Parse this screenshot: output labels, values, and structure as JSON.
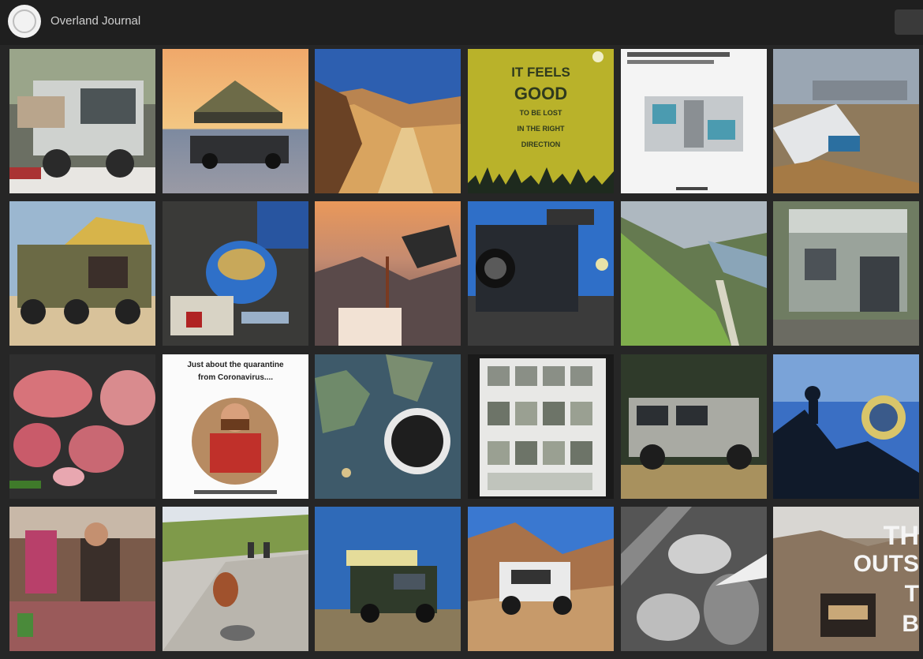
{
  "header": {
    "account_name": "Overland Journal",
    "avatar_icon": "profile-avatar-icon"
  },
  "posts": {
    "quote_card": {
      "line1": "IT FEELS",
      "line2": "GOOD",
      "line3": "TO BE LOST",
      "line4": "IN THE RIGHT",
      "line5": "DIRECTION"
    },
    "quarantine_card": {
      "line1": "Just about the quarantine",
      "line2": "from Coronavirus...."
    },
    "outside_card": {
      "line1": "TH",
      "line2": "OUTS",
      "line3": "T",
      "line4": "B"
    }
  },
  "colors": {
    "background": "#262626",
    "topbar": "#1f1f1f",
    "quote_card_bg": "#b9b22a"
  }
}
